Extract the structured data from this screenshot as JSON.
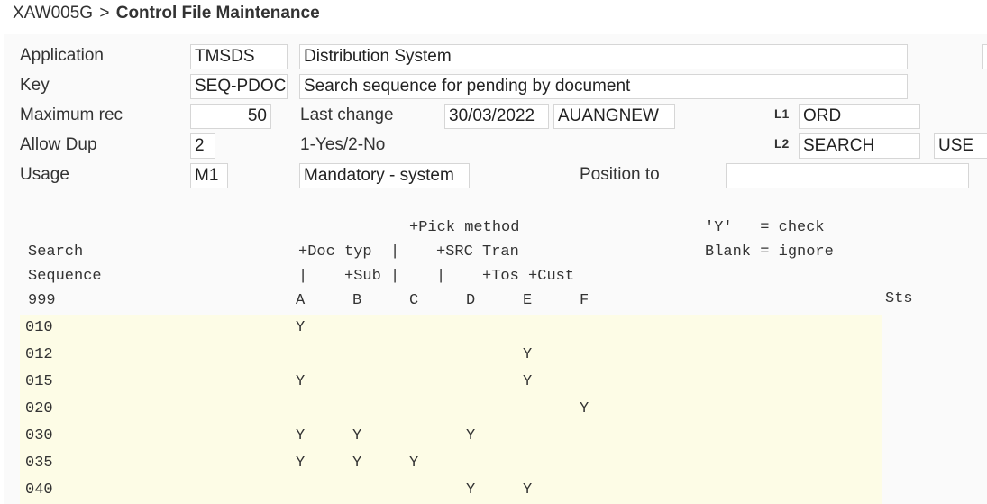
{
  "breadcrumb": {
    "program": "XAW005G",
    "separator": ">",
    "title": "Control File Maintenance"
  },
  "form": {
    "application_label": "Application",
    "application_code": "TMSDS",
    "application_desc": "Distribution System",
    "key_label": "Key",
    "key_value": "SEQ-PDOC",
    "key_desc": "Search sequence for pending by document",
    "maxrec_label": "Maximum rec",
    "maxrec_value": "50",
    "lastchange_label": "Last change",
    "lastchange_date": "30/03/2022",
    "lastchange_user": "AUANGNEW",
    "l1_label": "L1",
    "l1_value": "ORD",
    "allowdup_label": "Allow Dup",
    "allowdup_value": "2",
    "allowdup_hint": "1-Yes/2-No",
    "l2_label": "L2",
    "l2_value": "SEARCH",
    "l2_extra": "USE",
    "usage_label": "Usage",
    "usage_value": "M1",
    "usage_desc": "Mandatory - system",
    "position_label": "Position to",
    "position_value": ""
  },
  "grid_header": {
    "line1_pick": "+Pick method",
    "line1_legend": "'Y'   = check",
    "line2_left": "Search",
    "line2_mid": "+Doc typ  |    +SRC Tran",
    "line2_legend": "Blank = ignore",
    "line3_left": "Sequence",
    "line3_mid": "|    +Sub |    |    +Tos +Cust",
    "line4_left": "999",
    "col_a": "A",
    "col_b": "B",
    "col_c": "C",
    "col_d": "D",
    "col_e": "E",
    "col_f": "F",
    "sts": "Sts"
  },
  "rows": [
    {
      "seq": "010",
      "a": "Y",
      "b": "",
      "c": "",
      "d": "",
      "e": "",
      "f": ""
    },
    {
      "seq": "012",
      "a": "",
      "b": "",
      "c": "",
      "d": "",
      "e": "Y",
      "f": ""
    },
    {
      "seq": "015",
      "a": "Y",
      "b": "",
      "c": "",
      "d": "",
      "e": "Y",
      "f": ""
    },
    {
      "seq": "020",
      "a": "",
      "b": "",
      "c": "",
      "d": "",
      "e": "",
      "f": "Y"
    },
    {
      "seq": "030",
      "a": "Y",
      "b": "Y",
      "c": "",
      "d": "Y",
      "e": "",
      "f": ""
    },
    {
      "seq": "035",
      "a": "Y",
      "b": "Y",
      "c": "Y",
      "d": "",
      "e": "",
      "f": ""
    },
    {
      "seq": "040",
      "a": "",
      "b": "",
      "c": "",
      "d": "Y",
      "e": "Y",
      "f": ""
    }
  ]
}
